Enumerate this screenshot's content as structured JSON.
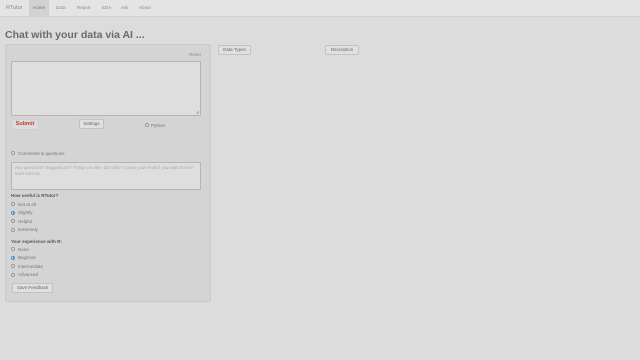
{
  "navbar": {
    "brand": "RTutor",
    "items": [
      {
        "label": "Home",
        "active": true
      },
      {
        "label": "Data"
      },
      {
        "label": "Report"
      },
      {
        "label": "EDA"
      },
      {
        "label": "Ask"
      },
      {
        "label": "About"
      }
    ]
  },
  "page": {
    "title": "Chat with your data via AI ..."
  },
  "panel": {
    "reset_label": "Reset",
    "submit_label": "Submit",
    "settings_label": "Settings",
    "python_label": "Python",
    "comments_label": "Comments & questions",
    "comments_placeholder": "Any questions? Suggestions? Things you like, don't like? Leave your email if you want to hear back from us.",
    "usefulness": {
      "question": "How useful is RTutor?",
      "options": [
        "Not at all",
        "Slightly",
        "Helpful",
        "Extremely"
      ],
      "selected": "Slightly"
    },
    "experience": {
      "question": "Your experience with R:",
      "options": [
        "None",
        "Beginner",
        "Intermediate",
        "Advanced"
      ],
      "selected": "Beginner"
    },
    "save_feedback_label": "Save Feedback"
  },
  "right": {
    "data_types_label": "Data Types",
    "description_label": "Description"
  },
  "colors": {
    "background": "#dcdcdc",
    "submit_text": "#c0392b",
    "link": "#6a8fb0",
    "radio_checked": "#4a90d9"
  }
}
